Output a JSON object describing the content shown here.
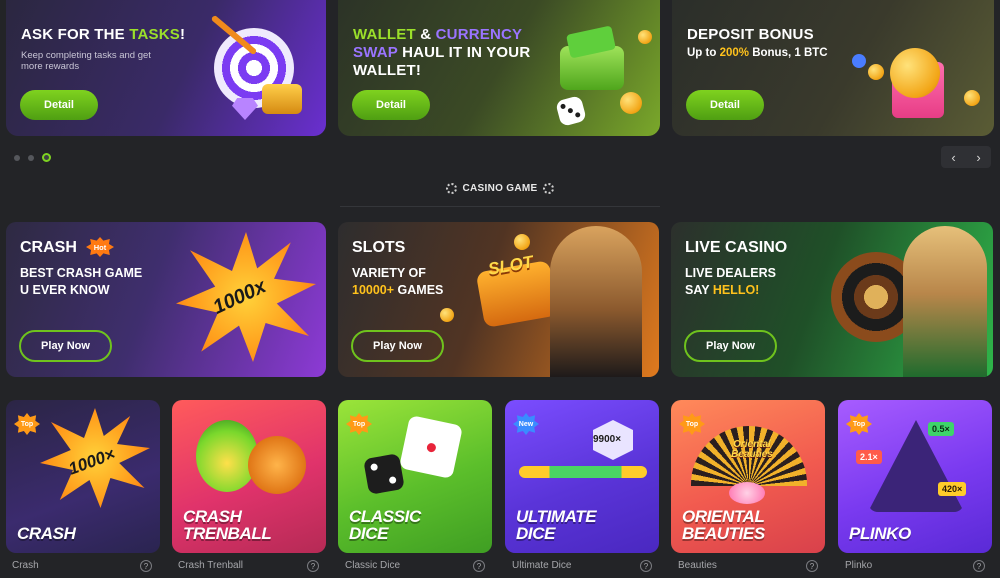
{
  "promos": [
    {
      "title_pre": "ASK FOR THE ",
      "title_hl": "TASKS",
      "title_post": "!",
      "desc": "Keep completing tasks and get more rewards",
      "button": "Detail"
    },
    {
      "title_l1a": "WALLET",
      "title_l1b": " & ",
      "title_l1c": "CURRENCY",
      "title_l2a": "SWAP",
      "title_l2b": " HAUL IT IN  YOUR",
      "title_l3": "WALLET!",
      "button": "Detail"
    },
    {
      "title": "DEPOSIT BONUS",
      "sub_a": "Up to ",
      "sub_b": "200%",
      "sub_c": " Bonus, 1 BTC",
      "button": "Detail"
    }
  ],
  "carousel": {
    "prev": "‹",
    "next": "›"
  },
  "section": {
    "title": "CASINO GAME"
  },
  "categories": [
    {
      "title": "CRASH",
      "badge": "Hot",
      "line1": "BEST CRASH GAME",
      "line2": "U EVER KNOW",
      "art_text": "1000x",
      "button": "Play Now"
    },
    {
      "title": "SLOTS",
      "line1": "VARIETY OF",
      "line2_hl": "10000+",
      "line2_rest": " GAMES",
      "art_text": "SLOT",
      "button": "Play Now"
    },
    {
      "title": "LIVE CASINO",
      "line1": "LIVE DEALERS",
      "line2_a": "SAY ",
      "line2_hl": "HELLO!",
      "button": "Play Now"
    }
  ],
  "games": [
    {
      "badge": "Top",
      "name_l1": "CRASH",
      "name_l2": "",
      "art_text": "1000×",
      "caption": "Crash"
    },
    {
      "badge": "",
      "name_l1": "CRASH",
      "name_l2": "TRENBALL",
      "art_text": "",
      "caption": "Crash Trenball"
    },
    {
      "badge": "Top",
      "name_l1": "CLASSIC",
      "name_l2": "DICE",
      "art_text": "",
      "caption": "Classic Dice"
    },
    {
      "badge": "New",
      "name_l1": "ULTIMATE",
      "name_l2": "DICE",
      "art_text": "9900×",
      "caption": "Ultimate Dice"
    },
    {
      "badge": "Top",
      "name_l1": "ORIENTAL",
      "name_l2": "BEAUTIES",
      "art_text": "Oriental Beauties",
      "caption": "Beauties"
    },
    {
      "badge": "Top",
      "name_l1": "PLINKO",
      "name_l2": "",
      "art_a": "0.5×",
      "art_b": "2.1×",
      "art_c": "420×",
      "caption": "Plinko"
    }
  ],
  "help_glyph": "?",
  "colors": {
    "accent_green": "#7ed321",
    "highlight_yellow": "#ffc21c",
    "highlight_purple": "#9a74ff",
    "background": "#232427"
  }
}
